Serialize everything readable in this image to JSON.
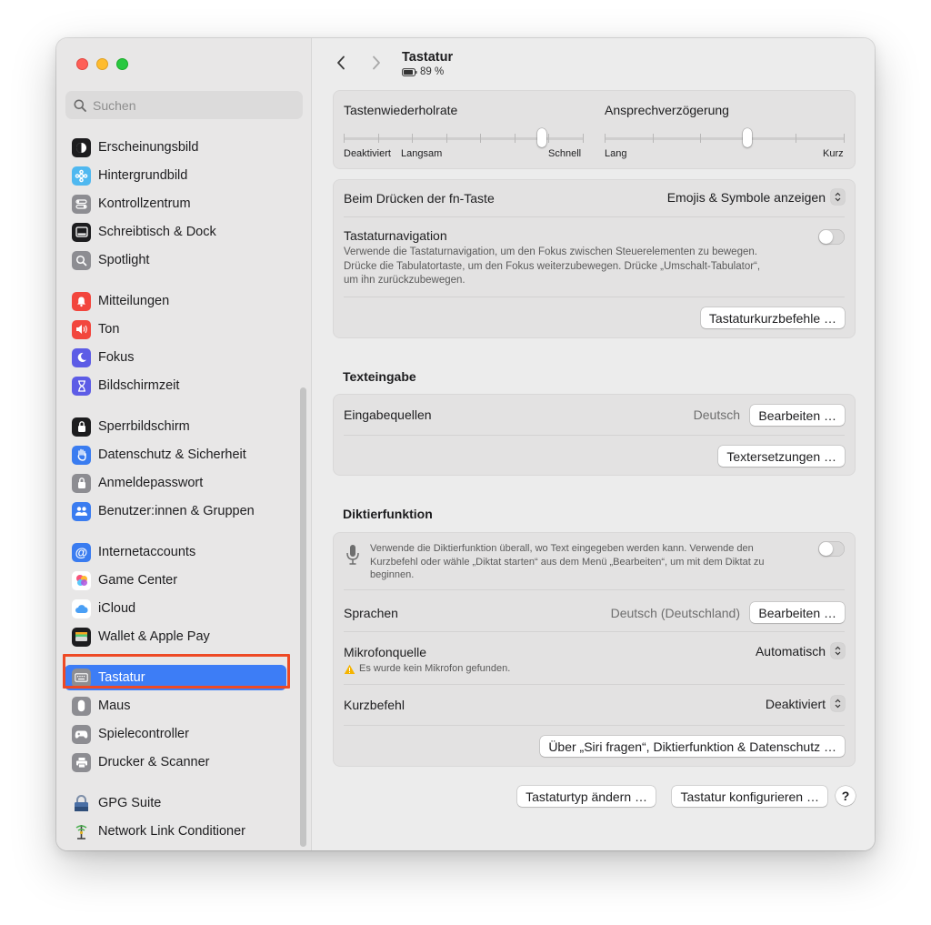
{
  "window": {
    "title": "Tastatur",
    "battery": "89 %"
  },
  "search": {
    "placeholder": "Suchen"
  },
  "sidebar": {
    "items": [
      {
        "label": "Erscheinungsbild",
        "icon": "appearance-icon"
      },
      {
        "label": "Hintergrundbild",
        "icon": "wallpaper-icon"
      },
      {
        "label": "Kontrollzentrum",
        "icon": "control-center-icon"
      },
      {
        "label": "Schreibtisch & Dock",
        "icon": "desktop-dock-icon"
      },
      {
        "label": "Spotlight",
        "icon": "spotlight-icon"
      },
      {
        "label": "Mitteilungen",
        "icon": "notifications-icon"
      },
      {
        "label": "Ton",
        "icon": "sound-icon"
      },
      {
        "label": "Fokus",
        "icon": "focus-moon-icon"
      },
      {
        "label": "Bildschirmzeit",
        "icon": "screen-time-hourglass-icon"
      },
      {
        "label": "Sperrbildschirm",
        "icon": "lock-screen-icon"
      },
      {
        "label": "Datenschutz & Sicherheit",
        "icon": "privacy-hand-icon"
      },
      {
        "label": "Anmeldepasswort",
        "icon": "login-password-lock-icon"
      },
      {
        "label": "Benutzer:innen & Gruppen",
        "icon": "users-groups-icon"
      },
      {
        "label": "Internetaccounts",
        "icon": "internet-accounts-at-icon"
      },
      {
        "label": "Game Center",
        "icon": "game-center-icon"
      },
      {
        "label": "iCloud",
        "icon": "icloud-icon"
      },
      {
        "label": "Wallet & Apple Pay",
        "icon": "wallet-icon"
      },
      {
        "label": "Tastatur",
        "icon": "keyboard-icon",
        "selected": true
      },
      {
        "label": "Maus",
        "icon": "mouse-icon"
      },
      {
        "label": "Spielecontroller",
        "icon": "game-controller-icon"
      },
      {
        "label": "Drucker & Scanner",
        "icon": "printer-icon"
      },
      {
        "label": "GPG Suite",
        "icon": "gpg-suite-icon"
      },
      {
        "label": "Network Link Conditioner",
        "icon": "network-link-conditioner-icon"
      }
    ]
  },
  "keyboard": {
    "repeat_rate": {
      "title": "Tastenwiederholrate",
      "min_label": "Deaktiviert",
      "left_label": "Langsam",
      "right_label": "Schnell",
      "value": 0.84
    },
    "delay": {
      "title": "Ansprechverzögerung",
      "left_label": "Lang",
      "right_label": "Kurz",
      "value": 0.6
    },
    "fn_key": {
      "label": "Beim Drücken der fn-Taste",
      "value": "Emojis & Symbole anzeigen"
    },
    "navigation": {
      "label": "Tastaturnavigation",
      "description": "Verwende die Tastaturnavigation, um den Fokus zwischen Steuerelementen zu bewegen. Drücke die Tabulatortaste, um den Fokus weiterzubewegen. Drücke „Umschalt-Tabulator“, um ihn zurückzubewegen.",
      "enabled": false
    },
    "shortcuts_button": "Tastaturkurzbefehle …"
  },
  "text_input": {
    "heading": "Texteingabe",
    "sources_label": "Eingabequellen",
    "sources_value": "Deutsch",
    "edit_button": "Bearbeiten …",
    "replacements_button": "Textersetzungen …"
  },
  "dictation": {
    "heading": "Diktierfunktion",
    "description": "Verwende die Diktierfunktion überall, wo Text eingegeben werden kann. Verwende den Kurzbefehl oder wähle „Diktat starten“ aus dem Menü „Bearbeiten“, um mit dem Diktat zu beginnen.",
    "enabled": false,
    "languages_label": "Sprachen",
    "languages_value": "Deutsch (Deutschland)",
    "edit_button": "Bearbeiten …",
    "mic_label": "Mikrofonquelle",
    "mic_value": "Automatisch",
    "mic_warning": "Es wurde kein Mikrofon gefunden.",
    "shortcut_label": "Kurzbefehl",
    "shortcut_value": "Deaktiviert",
    "about_button": "Über „Siri fragen“, Diktierfunktion & Datenschutz …"
  },
  "footer": {
    "change_type_button": "Tastaturtyp ändern …",
    "configure_button": "Tastatur konfigurieren …",
    "help_button": "?"
  },
  "colors": {
    "accent": "#3d7df6",
    "highlight_border": "#ee4a25"
  }
}
